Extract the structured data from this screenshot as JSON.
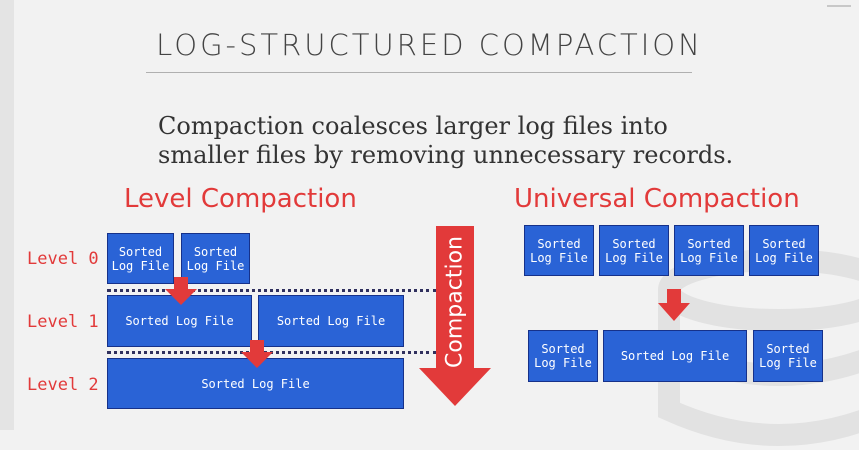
{
  "title": "LOG-STRUCTURED COMPACTION",
  "subtitle": "Compaction coalesces larger log files into smaller files by removing unnecessary records.",
  "level_compaction": {
    "heading": "Level Compaction",
    "levels": [
      {
        "label": "Level 0",
        "files": [
          "Sorted\nLog File",
          "Sorted\nLog File"
        ]
      },
      {
        "label": "Level 1",
        "files": [
          "Sorted Log File",
          "Sorted Log File"
        ]
      },
      {
        "label": "Level 2",
        "files": [
          "Sorted Log File"
        ]
      }
    ],
    "arrow_label": "Compaction"
  },
  "universal_compaction": {
    "heading": "Universal Compaction",
    "top_files": [
      "Sorted\nLog File",
      "Sorted\nLog File",
      "Sorted\nLog File",
      "Sorted\nLog File"
    ],
    "bottom_files": [
      "Sorted\nLog File",
      "Sorted Log File",
      "Sorted\nLog File"
    ]
  },
  "colors": {
    "box": "#2a63d6",
    "accent": "#e23a3a"
  }
}
